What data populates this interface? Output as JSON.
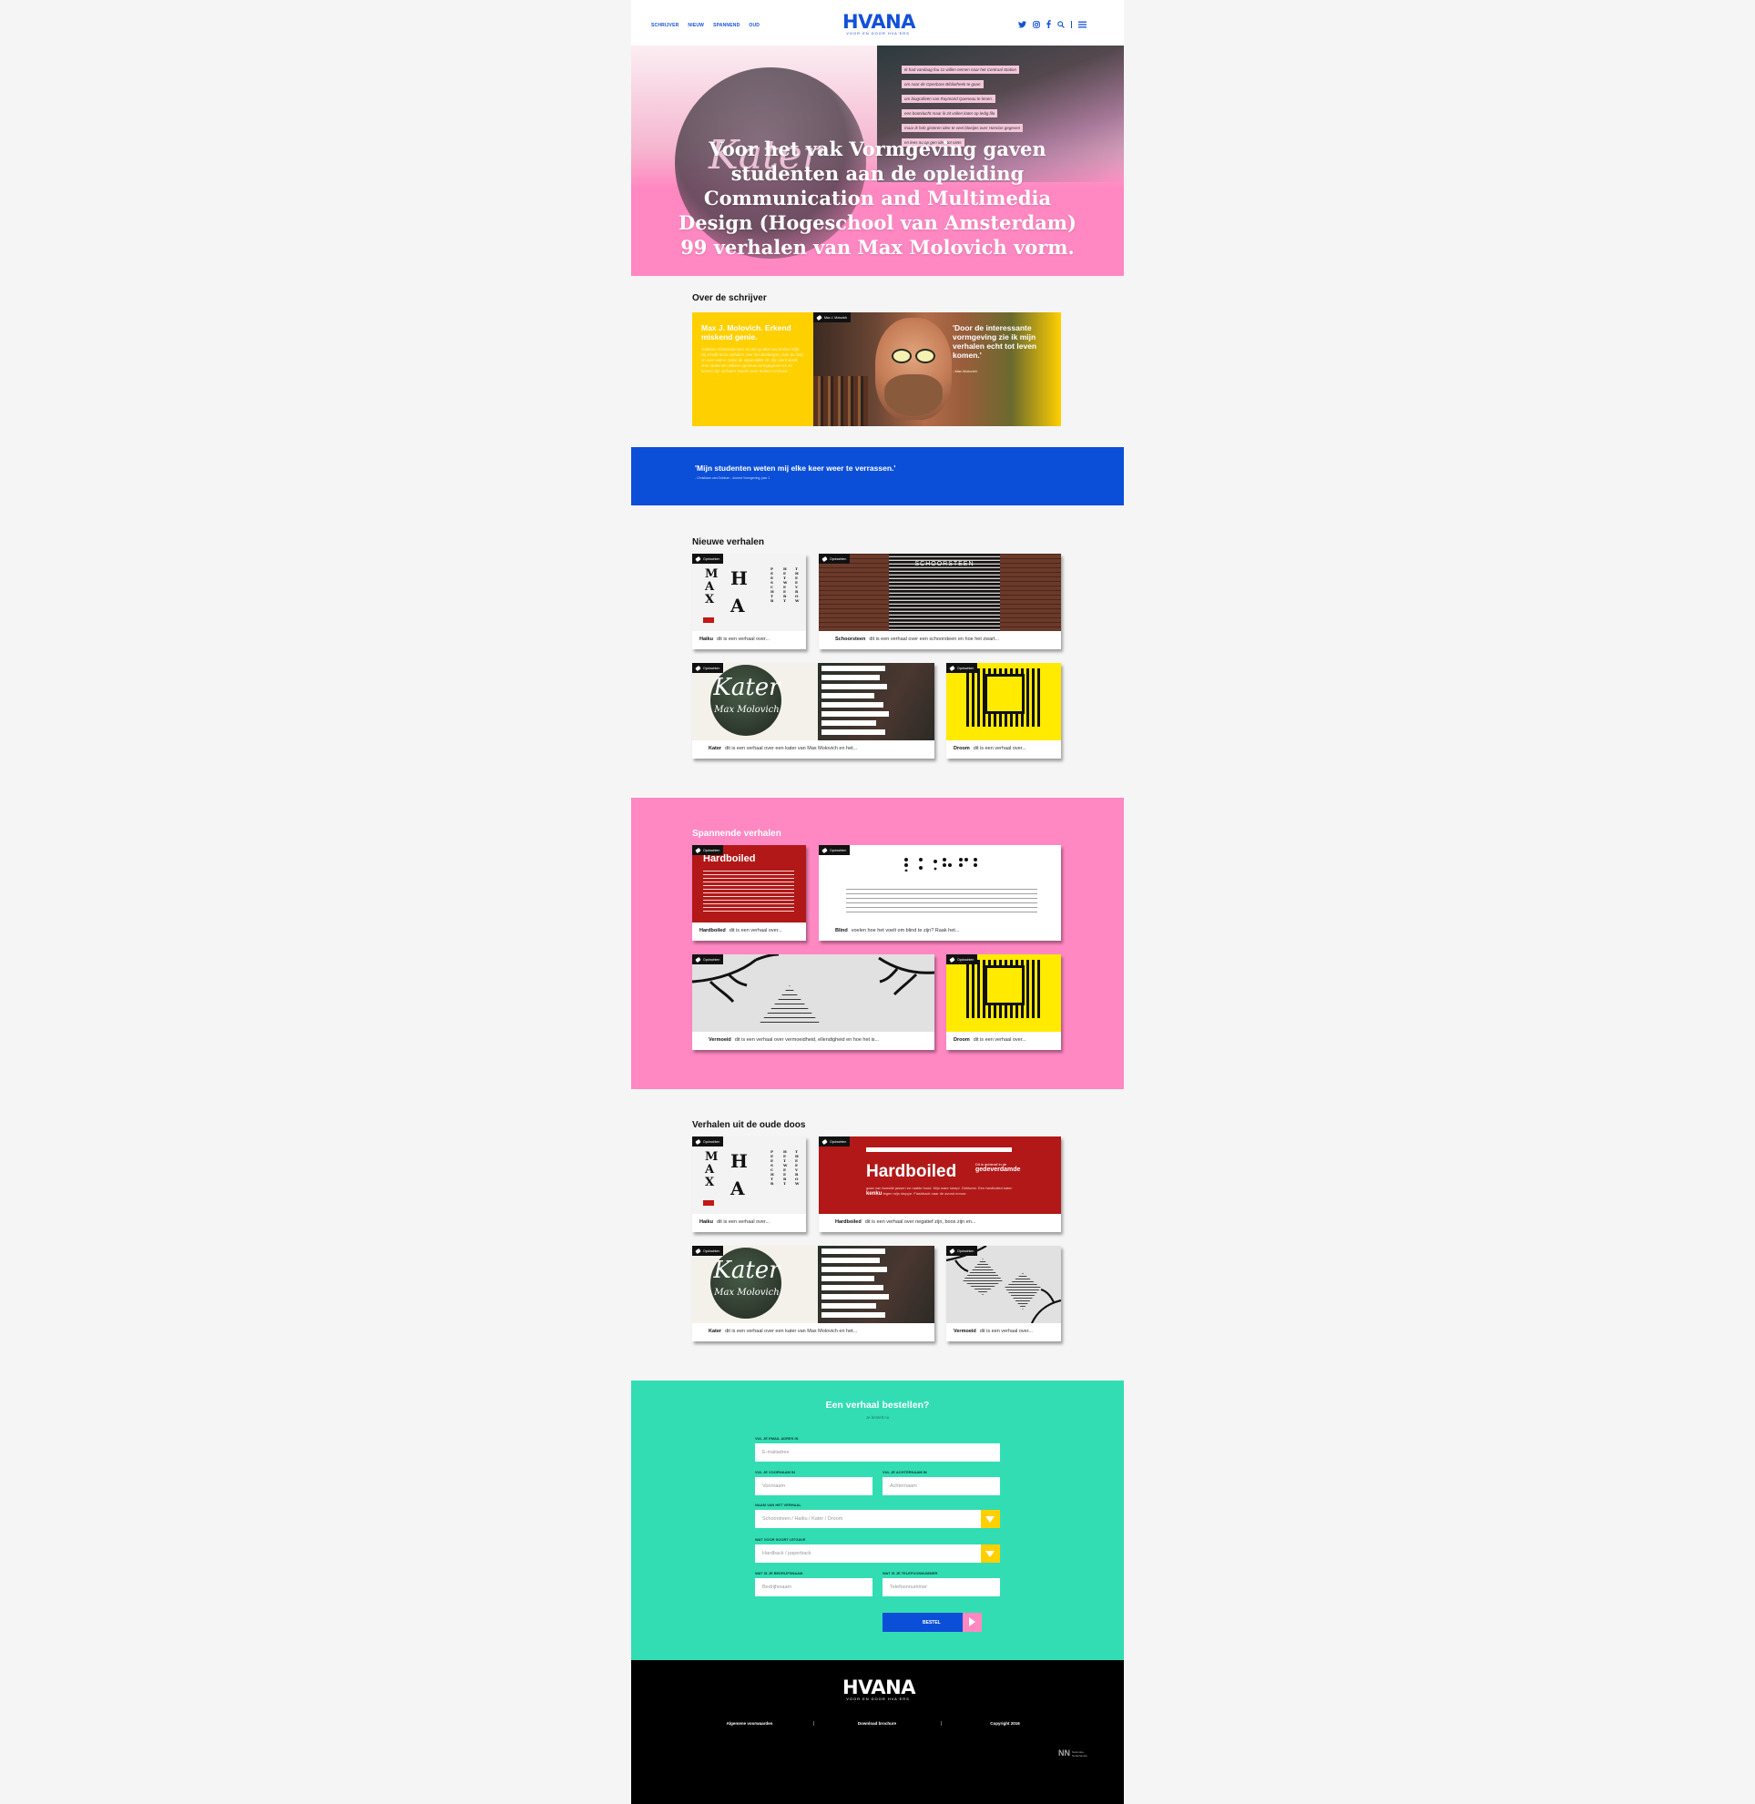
{
  "header": {
    "nav": [
      "SCHRIJVER",
      "NIEUW",
      "SPANNEND",
      "OUD"
    ],
    "logo": "HVANA",
    "tagline": "VOOR EN DOOR HVA'ERS"
  },
  "hero": {
    "script_word": "Kater",
    "text_lines": [
      "Ik had vandaag fou 11 willen nemen naar het Centraal Station",
      "om naar de Openbare Bibliotheek te gaan",
      "om biografieën van Raymond Queneau te lenen.",
      "een bootvlucht maar ik zit vollen kater op ledig filo",
      "maar ik heb gisteren idee te veel bloeijes over Henrion gegeven",
      "en lees nu op gen idee tot niets"
    ],
    "headline": "Voor het vak Vormgeving gaven studenten aan de opleiding Communication and Multimedia Design (Hogeschool van Amsterdam) 99 verhalen van Max Molovich vorm."
  },
  "about": {
    "title": "Over de schrijver",
    "card_heading": "Max J. Molovich. Erkend miskend genie.",
    "card_body": "Geboren Amsterdammer en dol op alles wat donker blijft. Hij schrijft korte verhalen over het alledaagse, over de stad en over wat er onder de oppervlakte zit. Zijn werk wordt door studenten telkens opnieuw vormgegeven en zo komen zijn verhalen steeds weer anders tot leven.",
    "photo_tag": "Max J. Molovich",
    "quote": "'Door de interessante vormgeving zie ik mijn verhalen echt tot leven komen.'",
    "quote_by": "- Max Molovich"
  },
  "band": {
    "quote": "'Mijn studenten weten mij elke keer weer te verrassen.'",
    "cite": "- Christiaan van Dokkum - docent Vormgeving, jaar 1"
  },
  "tag_label": "Opdrachten",
  "new_stories": {
    "title": "Nieuwe verhalen",
    "items": [
      {
        "name": "Haiku",
        "desc": "dit is een verhaal over..."
      },
      {
        "name": "Schoorsteen",
        "desc": "dit is een verhaal over een schoorsteen en hoe het zwart..."
      },
      {
        "name": "Kater",
        "desc": "dit is een verhaal over een kater van Max Molovich en het..."
      },
      {
        "name": "Droom",
        "desc": "dit is een verhaal over..."
      }
    ],
    "schoorsteen_title": "SCHOORSTEEN",
    "kater_title": "Kater",
    "kater_sub": "Max Molovich"
  },
  "exciting_stories": {
    "title": "Spannende verhalen",
    "items": [
      {
        "name": "Hardboiled",
        "desc": "dit is een verhaal over..."
      },
      {
        "name": "Blind",
        "desc": "voelen hoe het voelt om blind te zijn? Raak het..."
      },
      {
        "name": "Vermoeid",
        "desc": "dit is een verhaal over vermoeidheid, ellendigheid en hoe het is..."
      },
      {
        "name": "Droom",
        "desc": "dit is een verhaal over..."
      }
    ],
    "hardboiled_title": "Hardboiled"
  },
  "old_stories": {
    "title": "Verhalen uit de oude doos",
    "items": [
      {
        "name": "Haiku",
        "desc": "dit is een verhaal over..."
      },
      {
        "name": "Hardboiled",
        "desc": "dit is een verhaal over negatief zijn, boos zijn en..."
      },
      {
        "name": "Kater",
        "desc": "dit is een verhaal over een kater van Max Molovich en het..."
      },
      {
        "name": "Vermoeid",
        "desc": "dit is een verhaal over..."
      }
    ],
    "hardboiled_title": "Hardboiled",
    "hardboiled_side": "Dit is achteraf in de",
    "hardboiled_side2": "gedeverdamde",
    "hardboiled_body": "gaan van kwestie jassen en raakte bood. Mijn ware stoepi. Gebluest. Een hardboiled kater.",
    "hardboiled_bold": "kenku",
    "hardboiled_body2": "tegen mijn stoppe. Flashback naar de avond ervoor."
  },
  "order_form": {
    "title": "Een verhaal bestellen?",
    "subtitle": "Je bestelt nu",
    "email_label": "VUL JE EMAIL ADRES IN",
    "email_placeholder": "E-mailadres",
    "first_label": "VUL JE VOORNAAM IN",
    "first_placeholder": "Voornaam",
    "last_label": "VUL JE ACHTERNAAM IN",
    "last_placeholder": "Achternaam",
    "story_label": "NAAM VAN HET VERHAAL",
    "story_value": "Schoorsteen / Haiku / Kater / Droom",
    "edition_label": "WAT VOOR SOORT UITGAVE",
    "edition_value": "Hardback / paperback",
    "company_label": "WAT IS JE BEDRIJFSNAAM",
    "company_placeholder": "Bedrijfsnaam",
    "phone_label": "WAT IS JE TELEFOONNUMMER",
    "phone_placeholder": "Telefoonnummer",
    "submit": "BESTEL"
  },
  "footer": {
    "logo": "HVANA",
    "tagline": "VOOR EN DOOR HVA'ERS",
    "links": [
      "Algemene voorwaarden",
      "Download brochure",
      "Copyright 2016"
    ],
    "nn_mark": "NN",
    "nn_text": "Nationale-Nederlanden"
  },
  "colors": {
    "brand_blue": "#1450d8",
    "pink": "#ff88c2",
    "yellow": "#ffd000",
    "green": "#33ddb3",
    "red": "#b21818"
  }
}
